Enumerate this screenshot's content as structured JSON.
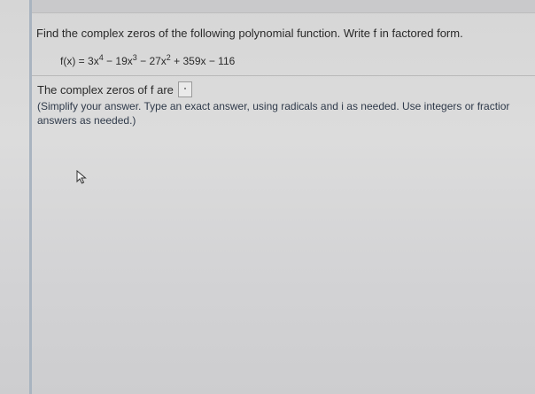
{
  "question": {
    "text": "Find the complex zeros of the following polynomial function. Write f in factored form."
  },
  "function": {
    "lhs": "f(x) = ",
    "t1_coef": "3x",
    "t1_exp": "4",
    "t2": " − 19x",
    "t2_exp": "3",
    "t3": " − 27x",
    "t3_exp": "2",
    "t4": " + 359x − 116"
  },
  "answer": {
    "label": "The complex zeros of f are"
  },
  "hint": {
    "line1": "(Simplify your answer. Type an exact answer, using radicals and i as needed. Use integers or fractior",
    "line2": "answers as needed.)"
  },
  "icons": {
    "cursor": "mouse-pointer-icon"
  }
}
